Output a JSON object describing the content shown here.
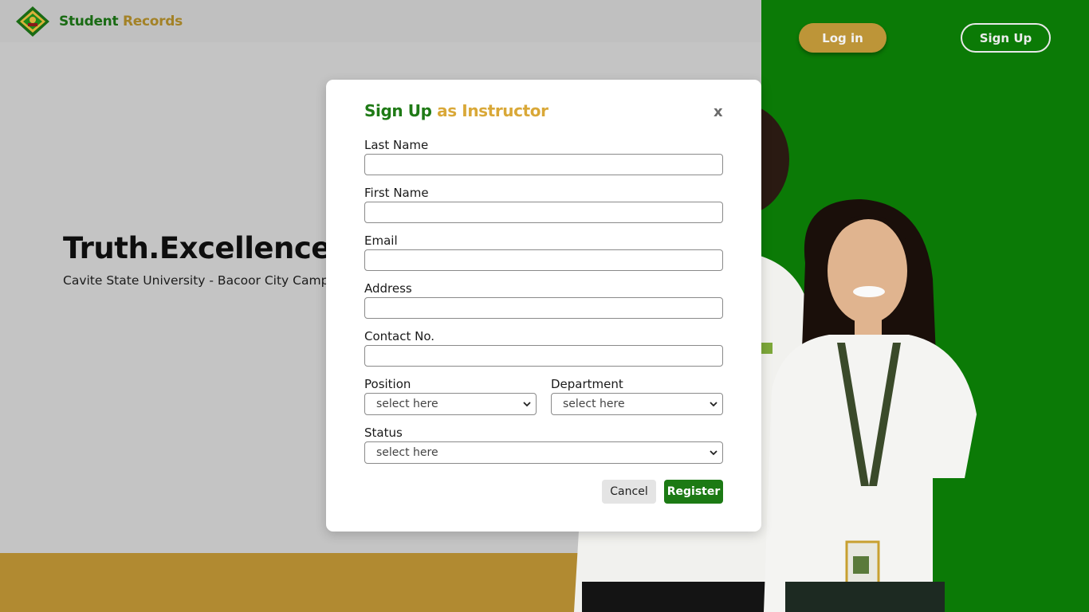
{
  "nav": {
    "brand_part1": "Student",
    "brand_part2": "Records",
    "login_label": "Log in",
    "signup_label": "Sign Up"
  },
  "hero": {
    "title": "Truth.Excellence.Service",
    "subtitle": "Cavite State University - Bacoor City Campus"
  },
  "modal": {
    "title_part1": "Sign Up",
    "title_part2": "as Instructor",
    "close_label": "x",
    "fields": {
      "last_name_label": "Last Name",
      "last_name_value": "",
      "first_name_label": "First Name",
      "first_name_value": "",
      "email_label": "Email",
      "email_value": "",
      "address_label": "Address",
      "address_value": "",
      "contact_label": "Contact No.",
      "contact_value": "",
      "position_label": "Position",
      "position_value": "select here",
      "department_label": "Department",
      "department_value": "select here",
      "status_label": "Status",
      "status_value": "select here"
    },
    "cancel_label": "Cancel",
    "register_label": "Register"
  },
  "colors": {
    "brand_green": "#1f7a16",
    "brand_gold": "#d9a838",
    "panel_green": "#0b7a06",
    "band_gold": "#b18a31"
  }
}
